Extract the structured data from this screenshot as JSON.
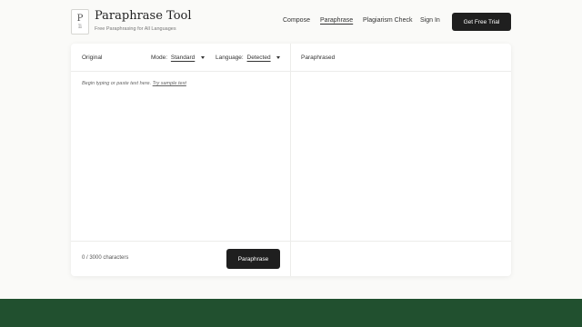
{
  "brand": {
    "logo_line1": "P",
    "logo_line2": "li",
    "title": "Paraphrase Tool",
    "subtitle": "Free Paraphrasing for All Languages"
  },
  "nav": {
    "items": [
      {
        "label": "Compose",
        "active": false
      },
      {
        "label": "Paraphrase",
        "active": true
      },
      {
        "label": "Plagiarism Check",
        "active": false
      },
      {
        "label": "Sign In",
        "active": false
      }
    ],
    "cta_label": "Get Free Trial"
  },
  "editor": {
    "original_label": "Original",
    "mode_label": "Mode:",
    "mode_value": "Standard",
    "language_label": "Language:",
    "language_value": "Detected",
    "placeholder": "Begin typing or paste text here.",
    "sample_link": "Try sample text",
    "char_count": "0 / 3000 characters",
    "submit_label": "Paraphrase"
  },
  "output": {
    "label": "Paraphrased"
  },
  "colors": {
    "footer_band": "#21502f",
    "button_dark": "#1f1f1f"
  }
}
